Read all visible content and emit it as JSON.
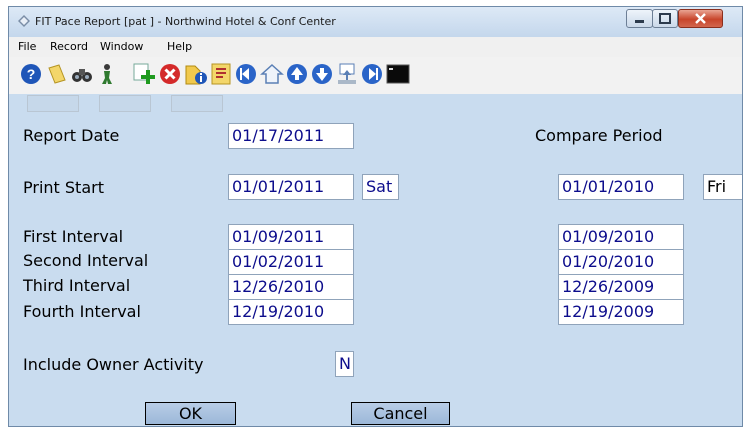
{
  "window": {
    "title": "FIT Pace Report [pat    ] - Northwind Hotel & Conf Center"
  },
  "menu": [
    "File",
    "Record",
    "Window",
    "Help"
  ],
  "toolbar_icons": [
    "help-icon",
    "note-icon",
    "binoculars-icon",
    "figure-icon",
    "add-icon",
    "delete-icon",
    "info-icon",
    "list-icon",
    "first-icon",
    "home-icon",
    "up-icon",
    "down-icon",
    "print-icon",
    "next-icon",
    "terminal-icon"
  ],
  "form": {
    "report_date_label": "Report Date",
    "report_date": "01/17/2011",
    "compare_period_label": "Compare Period",
    "print_start_label": "Print Start",
    "print_start": "01/01/2011",
    "print_start_day": "Sat",
    "compare_start": "01/01/2010",
    "compare_start_day": "Fri",
    "intervals": [
      {
        "label": "First Interval",
        "date": "01/09/2011",
        "compare": "01/09/2010"
      },
      {
        "label": "Second Interval",
        "date": "01/02/2011",
        "compare": "01/20/2010"
      },
      {
        "label": "Third Interval",
        "date": "12/26/2010",
        "compare": "12/26/2009"
      },
      {
        "label": "Fourth Interval",
        "date": "12/19/2010",
        "compare": "12/19/2009"
      }
    ],
    "owner_activity_label": "Include Owner Activity",
    "owner_activity": "N"
  },
  "buttons": {
    "ok": "OK",
    "cancel": "Cancel"
  },
  "colors": {
    "field_text": "#0d0d8c",
    "background": "#c9dcef"
  }
}
